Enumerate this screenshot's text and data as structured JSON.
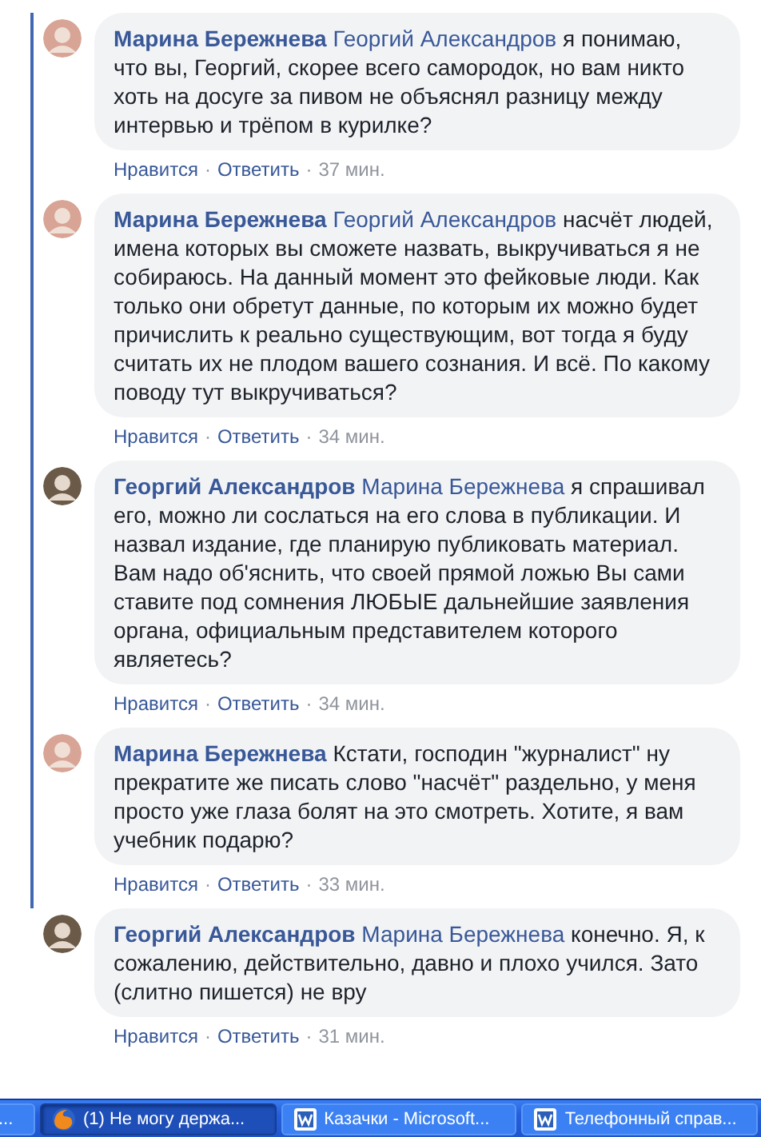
{
  "separator": "·",
  "comments": [
    {
      "author": "Марина Бережнева",
      "mention": "Георгий Александров",
      "text": "я понимаю, что вы, Георгий, скорее всего самородок, но вам никто хоть на досуге за пивом не объяснял разницу между интервью и трёпом в курилке?",
      "color": "#d8a496",
      "like": "Нравится",
      "reply": "Ответить",
      "time": "37 мин."
    },
    {
      "author": "Марина Бережнева",
      "mention": "Георгий Александров",
      "text": "насчёт людей, имена которых вы сможете назвать, выкручиваться я не собираюсь. На данный момент это фейковые люди. Как только они обретут данные, по которым их можно будет причислить к реально существующим, вот тогда я буду считать их не плодом вашего сознания. И всё. По какому поводу тут выкручиваться?",
      "color": "#d8a496",
      "like": "Нравится",
      "reply": "Ответить",
      "time": "34 мин."
    },
    {
      "author": "Георгий Александров",
      "mention": "Марина Бережнева",
      "text": "я спрашивал его, можно ли сослаться на его слова в публикации. И назвал издание, где планирую публиковать материал. Вам надо об'яснить, что своей прямой ложью Вы сами ставите под сомнения ЛЮБЫЕ дальнейшие заявления органа, официальным представителем которого являетесь?",
      "color": "#6b5a48",
      "like": "Нравится",
      "reply": "Ответить",
      "time": "34 мин."
    },
    {
      "author": "Марина Бережнева",
      "text": "Кстати, господин \"журналист\" ну прекратите же писать слово \"насчёт\" раздельно, у меня просто уже глаза болят на это смотреть. Хотите, я вам учебник подарю?",
      "color": "#d8a496",
      "like": "Нравится",
      "reply": "Ответить",
      "time": "33 мин."
    },
    {
      "author": "Георгий Александров",
      "mention": "Марина Бережнева",
      "text": "конечно. Я, к сожалению, действительно, давно и плохо учился. Зато (слитно пишется) не вру",
      "color": "#6b5a48",
      "like": "Нравится",
      "reply": "Ответить",
      "time": "31 мин."
    }
  ],
  "taskbar": [
    {
      "kind": "stub",
      "label": "...",
      "selected": false
    },
    {
      "kind": "browser",
      "label": "(1) Не могу держа...",
      "selected": true
    },
    {
      "kind": "document",
      "label": "Казачки - Microsoft...",
      "selected": false
    },
    {
      "kind": "document",
      "label": "Телефонный справ...",
      "selected": false
    }
  ]
}
